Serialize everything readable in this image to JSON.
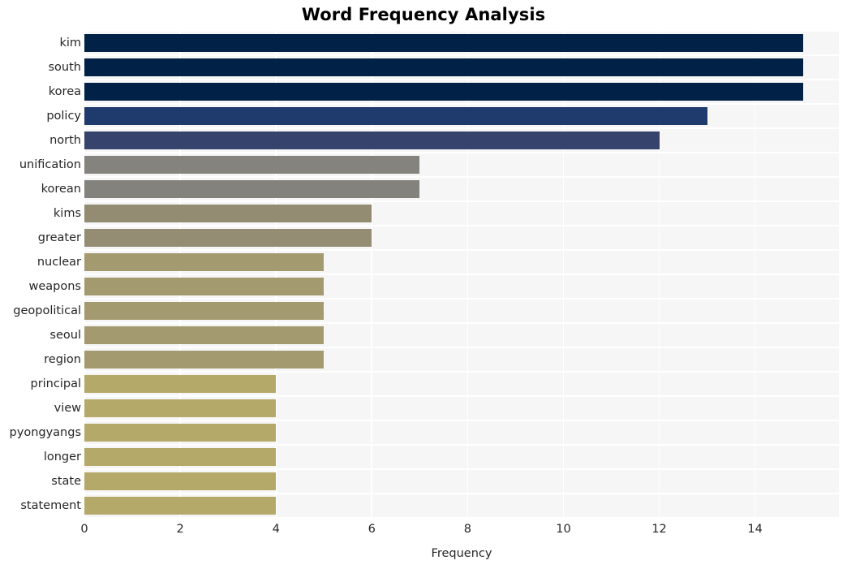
{
  "chart_data": {
    "type": "bar",
    "orientation": "horizontal",
    "title": "Word Frequency Analysis",
    "xlabel": "Frequency",
    "ylabel": "",
    "xlim": [
      0,
      15.75
    ],
    "xticks": [
      0,
      2,
      4,
      6,
      8,
      10,
      12,
      14
    ],
    "xticklabels": [
      "0",
      "2",
      "4",
      "6",
      "8",
      "10",
      "12",
      "14"
    ],
    "grid": true,
    "grid_axis": "both",
    "grid_color": "#ffffff",
    "plot_background": "#f6f6f7",
    "figure_background": "#ffffff",
    "legend": null,
    "categories": [
      "kim",
      "south",
      "korea",
      "policy",
      "north",
      "unification",
      "korean",
      "kims",
      "greater",
      "nuclear",
      "weapons",
      "geopolitical",
      "seoul",
      "region",
      "principal",
      "view",
      "pyongyangs",
      "longer",
      "state",
      "statement"
    ],
    "values": [
      15,
      15,
      15,
      13,
      12,
      7,
      7,
      6,
      6,
      5,
      5,
      5,
      5,
      5,
      4,
      4,
      4,
      4,
      4,
      4
    ],
    "bar_colors": [
      "#012147",
      "#012147",
      "#012147",
      "#1f3a6d",
      "#36436c",
      "#84837d",
      "#83827c",
      "#938c72",
      "#948d73",
      "#a49a6f",
      "#a49a6f",
      "#a49a6f",
      "#a49a6f",
      "#a49a6f",
      "#b5a96a",
      "#b5a96a",
      "#b5a96a",
      "#b5a96a",
      "#b5a96a",
      "#b5a96a"
    ]
  }
}
